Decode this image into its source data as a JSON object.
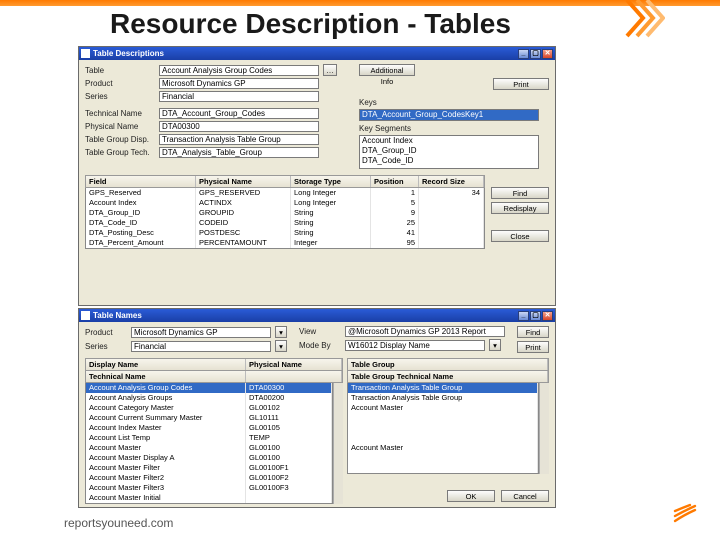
{
  "slide": {
    "title": "Resource Description - Tables",
    "footer": "reportsyouneed.com"
  },
  "win1": {
    "title": "Table Descriptions",
    "labels": {
      "table": "Table",
      "product": "Product",
      "series": "Series",
      "techName": "Technical Name",
      "physName": "Physical Name",
      "tableGroup": "Table Group Disp.",
      "tableGroupTech": "Table Group Tech.",
      "keys": "Keys",
      "keySegments": "Key Segments"
    },
    "fields": {
      "table": "Account Analysis Group Codes",
      "product": "Microsoft Dynamics GP",
      "series": "Financial",
      "techName": "DTA_Account_Group_Codes",
      "physName": "DTA00300",
      "tableGroup": "Transaction Analysis Table Group",
      "tableGroupTech": "DTA_Analysis_Table_Group",
      "keysSelected": "DTA_Account_Group_CodesKey1"
    },
    "keySegments": [
      "Account Index",
      "DTA_Group_ID",
      "DTA_Code_ID"
    ],
    "buttons": {
      "additional": "Additional Info",
      "print": "Print",
      "find": "Find",
      "redisplay": "Redisplay",
      "close": "Close"
    },
    "gridHeaders": {
      "field": "Field",
      "phys": "Physical Name",
      "storage": "Storage Type",
      "pos": "Position",
      "record": "Record Size"
    },
    "gridRows": [
      {
        "f": "GPS_Reserved",
        "p": "GPS_RESERVED",
        "s": "Long Integer",
        "pos": "1",
        "r": "34"
      },
      {
        "f": "Account Index",
        "p": "ACTINDX",
        "s": "Long Integer",
        "pos": "5",
        "r": ""
      },
      {
        "f": "DTA_Group_ID",
        "p": "GROUPID",
        "s": "String",
        "pos": "9",
        "r": ""
      },
      {
        "f": "DTA_Code_ID",
        "p": "CODEID",
        "s": "String",
        "pos": "25",
        "r": ""
      },
      {
        "f": "DTA_Posting_Desc",
        "p": "POSTDESC",
        "s": "String",
        "pos": "41",
        "r": ""
      },
      {
        "f": "DTA_Percent_Amount",
        "p": "PERCENTAMOUNT",
        "s": "Integer",
        "pos": "95",
        "r": ""
      }
    ]
  },
  "win2": {
    "title": "Table Names",
    "labels": {
      "product": "Product",
      "series": "Series",
      "view": "View",
      "modeby": "Mode By"
    },
    "fields": {
      "product": "Microsoft Dynamics GP",
      "series": "Financial",
      "view": "@Microsoft Dynamics GP 2013 Report",
      "modeby": "W16012 Display Name"
    },
    "buttons": {
      "find": "Find",
      "print": "Print",
      "ok": "OK",
      "cancel": "Cancel"
    },
    "leftHeaders": {
      "display": "Display Name",
      "tech": "Technical Name",
      "phys": "Physical Name"
    },
    "rightHeaders": {
      "tg": "Table Group",
      "tgtech": "Table Group Technical Name"
    },
    "leftRows": [
      {
        "d": "Account Analysis Group Codes",
        "p": "DTA00300",
        "sel": true
      },
      {
        "d": "Account Analysis Groups",
        "p": "DTA00200",
        "sel": false
      },
      {
        "d": "Account Category Master",
        "p": "GL00102",
        "sel": false
      },
      {
        "d": "Account Current Summary Master",
        "p": "GL10111",
        "sel": false
      },
      {
        "d": "Account Index Master",
        "p": "GL00105",
        "sel": false
      },
      {
        "d": "Account List Temp",
        "p": "TEMP",
        "sel": false
      },
      {
        "d": "Account Master",
        "p": "GL00100",
        "sel": false
      },
      {
        "d": "Account Master Display A",
        "p": "GL00100",
        "sel": false
      },
      {
        "d": "Account Master Filter",
        "p": "GL00100F1",
        "sel": false
      },
      {
        "d": "Account Master Filter2",
        "p": "GL00100F2",
        "sel": false
      },
      {
        "d": "Account Master Filter3",
        "p": "GL00100F3",
        "sel": false
      },
      {
        "d": "Account Master Initial",
        "p": "",
        "sel": false
      }
    ],
    "rightRows": [
      {
        "t": "Transaction Analysis Table Group",
        "sel": true
      },
      {
        "t": "Transaction Analysis Table Group",
        "sel": false
      },
      {
        "t": "Account Master",
        "sel": false
      },
      {
        "t": "",
        "sel": false
      },
      {
        "t": "",
        "sel": false
      },
      {
        "t": "",
        "sel": false
      },
      {
        "t": "Account Master",
        "sel": false
      },
      {
        "t": "",
        "sel": false
      },
      {
        "t": "",
        "sel": false
      }
    ]
  }
}
